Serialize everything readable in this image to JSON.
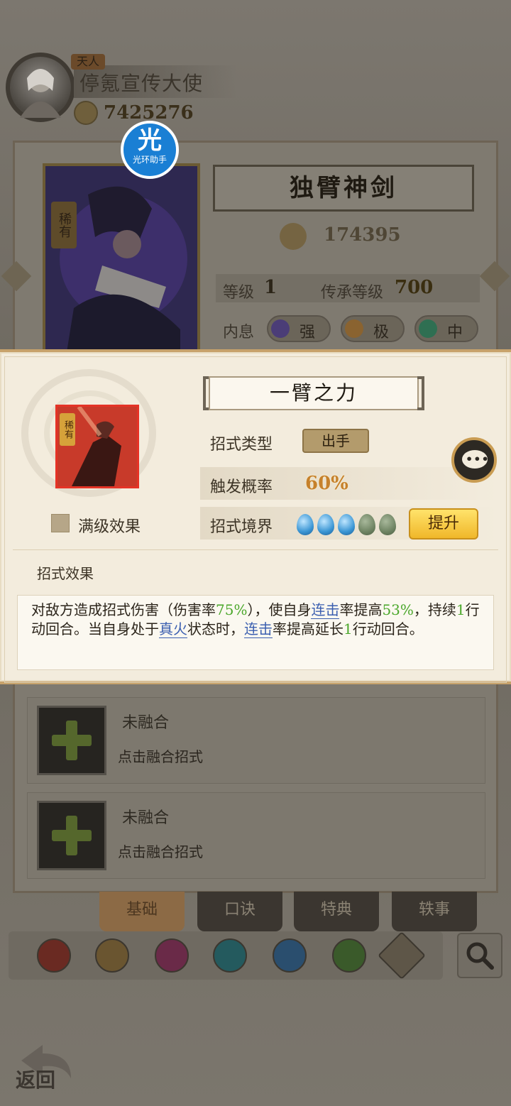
{
  "player": {
    "title_badge": "天人",
    "name": "停氪宣传大使",
    "power": "7425276"
  },
  "watermark": {
    "glyph": "光",
    "label": "光环助手"
  },
  "hero": {
    "name": "独臂神剑",
    "rarity": "稀有",
    "power": "174395",
    "level_label": "等级",
    "level": "1",
    "inherit_label": "传承等级",
    "inherit_level": "700",
    "neixi_label": "内息",
    "neixi": [
      {
        "label": "强",
        "color": "#4b3d77"
      },
      {
        "label": "极",
        "color": "#8a6330"
      },
      {
        "label": "中",
        "color": "#2f6f52"
      }
    ]
  },
  "skill": {
    "name": "一臂之力",
    "rarity": "稀有",
    "max_effect_label": "满级效果",
    "type_label": "招式类型",
    "type_value": "出手",
    "trigger_label": "触发概率",
    "trigger_value": "60%",
    "realm_label": "招式境界",
    "realm_lit": 3,
    "realm_total": 5,
    "upgrade_label": "提升",
    "effect_title": "招式效果",
    "effect": {
      "p1": "对敌方造成招式伤害（伤害率",
      "p2": "75%",
      "p3": "），使自身",
      "p4": "连击",
      "p5": "率提高",
      "p6": "53%",
      "p7": "，持续",
      "p8": "1",
      "p9": "行动回合。当自身处于",
      "p10": "真火",
      "p11": "状态时，",
      "p12": "连击",
      "p13": "率提高延长",
      "p14": "1",
      "p15": "行动回合。"
    }
  },
  "fusion": [
    {
      "title": "未融合",
      "hint": "点击融合招式"
    },
    {
      "title": "未融合",
      "hint": "点击融合招式"
    }
  ],
  "tabs": [
    "基础",
    "口诀",
    "特典",
    "轶事"
  ],
  "sect_icons": [
    "sword-sect",
    "shield-sect",
    "fist-sect",
    "fan-sect",
    "taiji-sect",
    "jade-sect",
    "mountain-sect"
  ],
  "back_label": "返回",
  "colors": {
    "accent_gold": "#f0b72a",
    "highlight_green": "#4aa72a",
    "link_blue": "#3b5fb0",
    "popup_bg": "#f3ecdd"
  }
}
